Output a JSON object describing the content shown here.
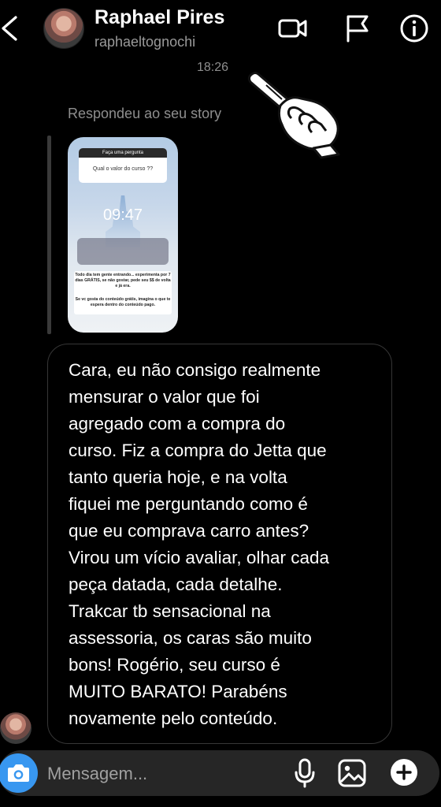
{
  "status_bar": {
    "fragment": ""
  },
  "header": {
    "name": "Raphael Pires",
    "username": "raphaeltognochi"
  },
  "thread": {
    "timestamp": "18:26",
    "story_reply_label": "Respondeu ao seu story",
    "story_preview": {
      "header_text": "Faça uma pergunta",
      "question": "Qual o valor do curso ??",
      "clock": "09:47",
      "caption_1": "Todo dia tem gente entrando... experimenta por 7 dias GRÁTIS, se não gostar, pede seu $$ de volta e já era.",
      "caption_2": "Se vc gosta do conteúdo grátis, imagina o que te espera dentro do conteúdo pago."
    },
    "message_lines": [
      "Cara, eu não consigo realmente",
      "mensurar o valor que foi",
      "agregado com a compra do",
      "curso. Fiz a compra do Jetta que",
      "tanto queria hoje, e na volta",
      "fiquei me perguntando como é",
      "que eu comprava carro antes?",
      "Virou um vício avaliar, olhar cada",
      "peça datada, cada detalhe.",
      "Trakcar tb sensacional na",
      "assessoria, os caras são muito",
      "bons! Rogério, seu curso é",
      "MUITO BARATO! Parabéns",
      "novamente pelo conteúdo."
    ]
  },
  "composer": {
    "placeholder": "Mensagem..."
  },
  "colors": {
    "background": "#000000",
    "bubble_border": "#363636",
    "composer_bg": "#262626",
    "camera_blue": "#3897f0",
    "muted_text": "#8e8e8e"
  },
  "icons": [
    "back-icon",
    "video-call-icon",
    "flag-icon",
    "info-icon",
    "pointing-hand-icon",
    "camera-icon",
    "mic-icon",
    "gallery-icon",
    "plus-icon"
  ]
}
